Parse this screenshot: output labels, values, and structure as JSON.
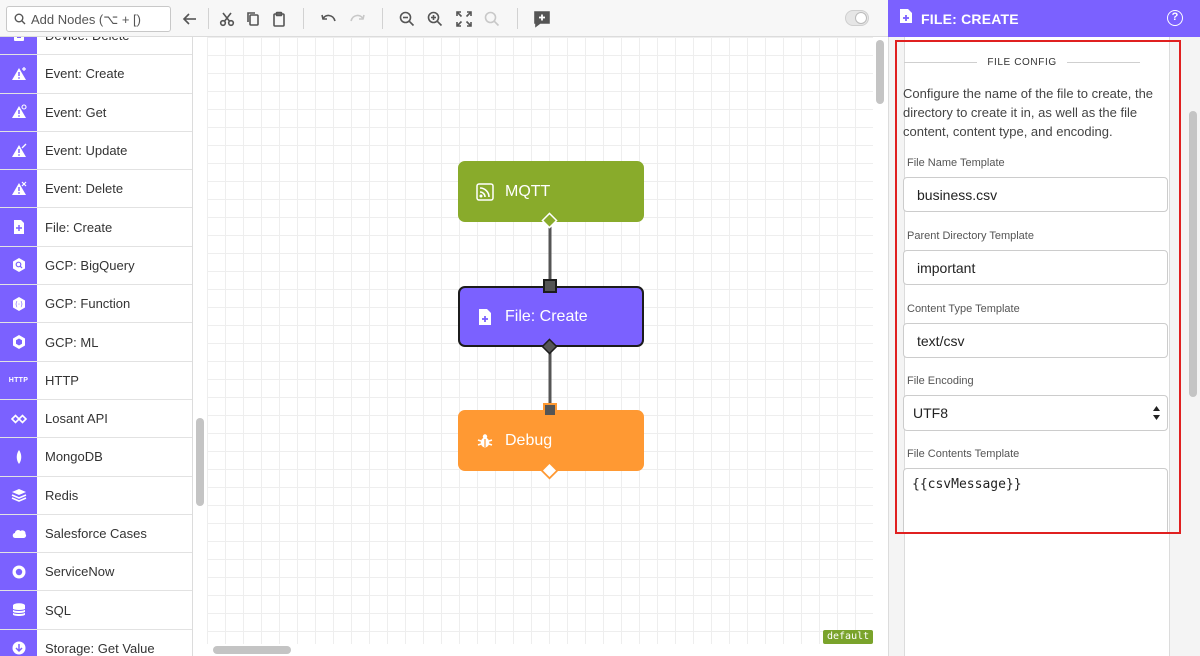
{
  "toolbar": {
    "search_placeholder": "Add Nodes (⌥ + [)"
  },
  "palette": {
    "items": [
      {
        "label": "Device: Delete",
        "icon": "device-icon"
      },
      {
        "label": "Event: Create",
        "icon": "event-create-icon"
      },
      {
        "label": "Event: Get",
        "icon": "event-get-icon"
      },
      {
        "label": "Event: Update",
        "icon": "event-update-icon"
      },
      {
        "label": "Event: Delete",
        "icon": "event-delete-icon"
      },
      {
        "label": "File: Create",
        "icon": "file-create-icon"
      },
      {
        "label": "GCP: BigQuery",
        "icon": "gcp-bigquery-icon"
      },
      {
        "label": "GCP: Function",
        "icon": "gcp-function-icon"
      },
      {
        "label": "GCP: ML",
        "icon": "gcp-ml-icon"
      },
      {
        "label": "HTTP",
        "icon": "http-icon"
      },
      {
        "label": "Losant API",
        "icon": "losant-api-icon"
      },
      {
        "label": "MongoDB",
        "icon": "mongodb-icon"
      },
      {
        "label": "Redis",
        "icon": "redis-icon"
      },
      {
        "label": "Salesforce Cases",
        "icon": "salesforce-icon"
      },
      {
        "label": "ServiceNow",
        "icon": "servicenow-icon"
      },
      {
        "label": "SQL",
        "icon": "sql-icon"
      },
      {
        "label": "Storage: Get Value",
        "icon": "storage-icon"
      }
    ],
    "http_icon_text": "HTTP"
  },
  "canvas": {
    "badge": "default",
    "nodes": [
      {
        "label": "MQTT",
        "icon": "rss-icon",
        "color": "#89ab2b"
      },
      {
        "label": "File: Create",
        "icon": "file-plus-icon",
        "color": "#7b61ff"
      },
      {
        "label": "Debug",
        "icon": "bug-icon",
        "color": "#ff9933"
      }
    ]
  },
  "panel": {
    "title": "FILE: CREATE",
    "help": "?",
    "section_title": "FILE CONFIG",
    "description": "Configure the name of the file to create, the directory to create it in, as well as the file content, content type, and encoding.",
    "fields": {
      "file_name": {
        "label": "File Name Template",
        "value": "business.csv"
      },
      "parent_dir": {
        "label": "Parent Directory Template",
        "value": "important"
      },
      "content_type": {
        "label": "Content Type Template",
        "value": "text/csv"
      },
      "encoding": {
        "label": "File Encoding",
        "value": "UTF8"
      },
      "contents": {
        "label": "File Contents Template",
        "value": "{{csvMessage}}"
      }
    }
  },
  "colors": {
    "accent": "#7b61ff",
    "mqtt": "#89ab2b",
    "debug": "#ff9933",
    "highlight": "#e02020"
  }
}
